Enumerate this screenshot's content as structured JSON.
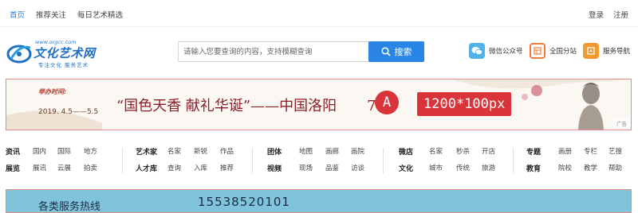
{
  "topbar": {
    "left_links": [
      "首页",
      "推荐关注",
      "每日艺术精选"
    ],
    "login": "登录",
    "register": "注册"
  },
  "header": {
    "logo": {
      "url_text": "www.orgcc.com",
      "name": "文化艺术网",
      "slogan": "专注文化  服务艺术"
    },
    "search": {
      "placeholder": "请输入您要查询的内容，支持模糊查询",
      "button_label": "搜索"
    },
    "quick_links": [
      {
        "label": "微信公众号",
        "icon": "wechat-icon",
        "color": "#4fb3e8"
      },
      {
        "label": "全国分站",
        "icon": "branch-icon",
        "color": "#f07a3a"
      },
      {
        "label": "服务导航",
        "icon": "service-icon",
        "color": "#f29a2e"
      }
    ]
  },
  "banner1": {
    "event_label": "举办时间:",
    "event_date": "2019. 4.5——5.5",
    "headline": "“国色天香 献礼华诞”——中国洛阳",
    "ad_letter": "A",
    "ad_size": "1200*100px",
    "ad_tag": "广告",
    "headline_suffix": "7"
  },
  "catnav": {
    "groups": [
      {
        "rows": [
          {
            "head": "资讯",
            "links": [
              "国内",
              "国际",
              "地方"
            ]
          },
          {
            "head": "展览",
            "links": [
              "展讯",
              "云展",
              "拍卖"
            ]
          }
        ]
      },
      {
        "rows": [
          {
            "head": "艺术家",
            "links": [
              "名家",
              "新锐",
              "作品"
            ]
          },
          {
            "head": "人才库",
            "links": [
              "查询",
              "入库",
              "推荐"
            ]
          }
        ]
      },
      {
        "rows": [
          {
            "head": "团体",
            "links": [
              "地图",
              "画廊",
              "画院"
            ]
          },
          {
            "head": "视频",
            "links": [
              "现场",
              "品鉴",
              "访谈"
            ]
          }
        ]
      },
      {
        "rows": [
          {
            "head": "微店",
            "links": [
              "名家",
              "秒杀",
              "开店"
            ]
          },
          {
            "head": "文化",
            "links": [
              "城市",
              "传统",
              "旅游"
            ]
          }
        ]
      },
      {
        "rows": [
          {
            "head": "专题",
            "links": [
              "画册",
              "专栏",
              "艺搜"
            ]
          },
          {
            "head": "教育",
            "links": [
              "院校",
              "教学",
              "帮助"
            ]
          }
        ]
      }
    ]
  },
  "banner2": {
    "text": "各类服务热线",
    "phone": "15538520101"
  },
  "colors": {
    "brand": "#1f6fc5",
    "search_button": "#2a86e6",
    "ad_red": "#d9343a"
  }
}
